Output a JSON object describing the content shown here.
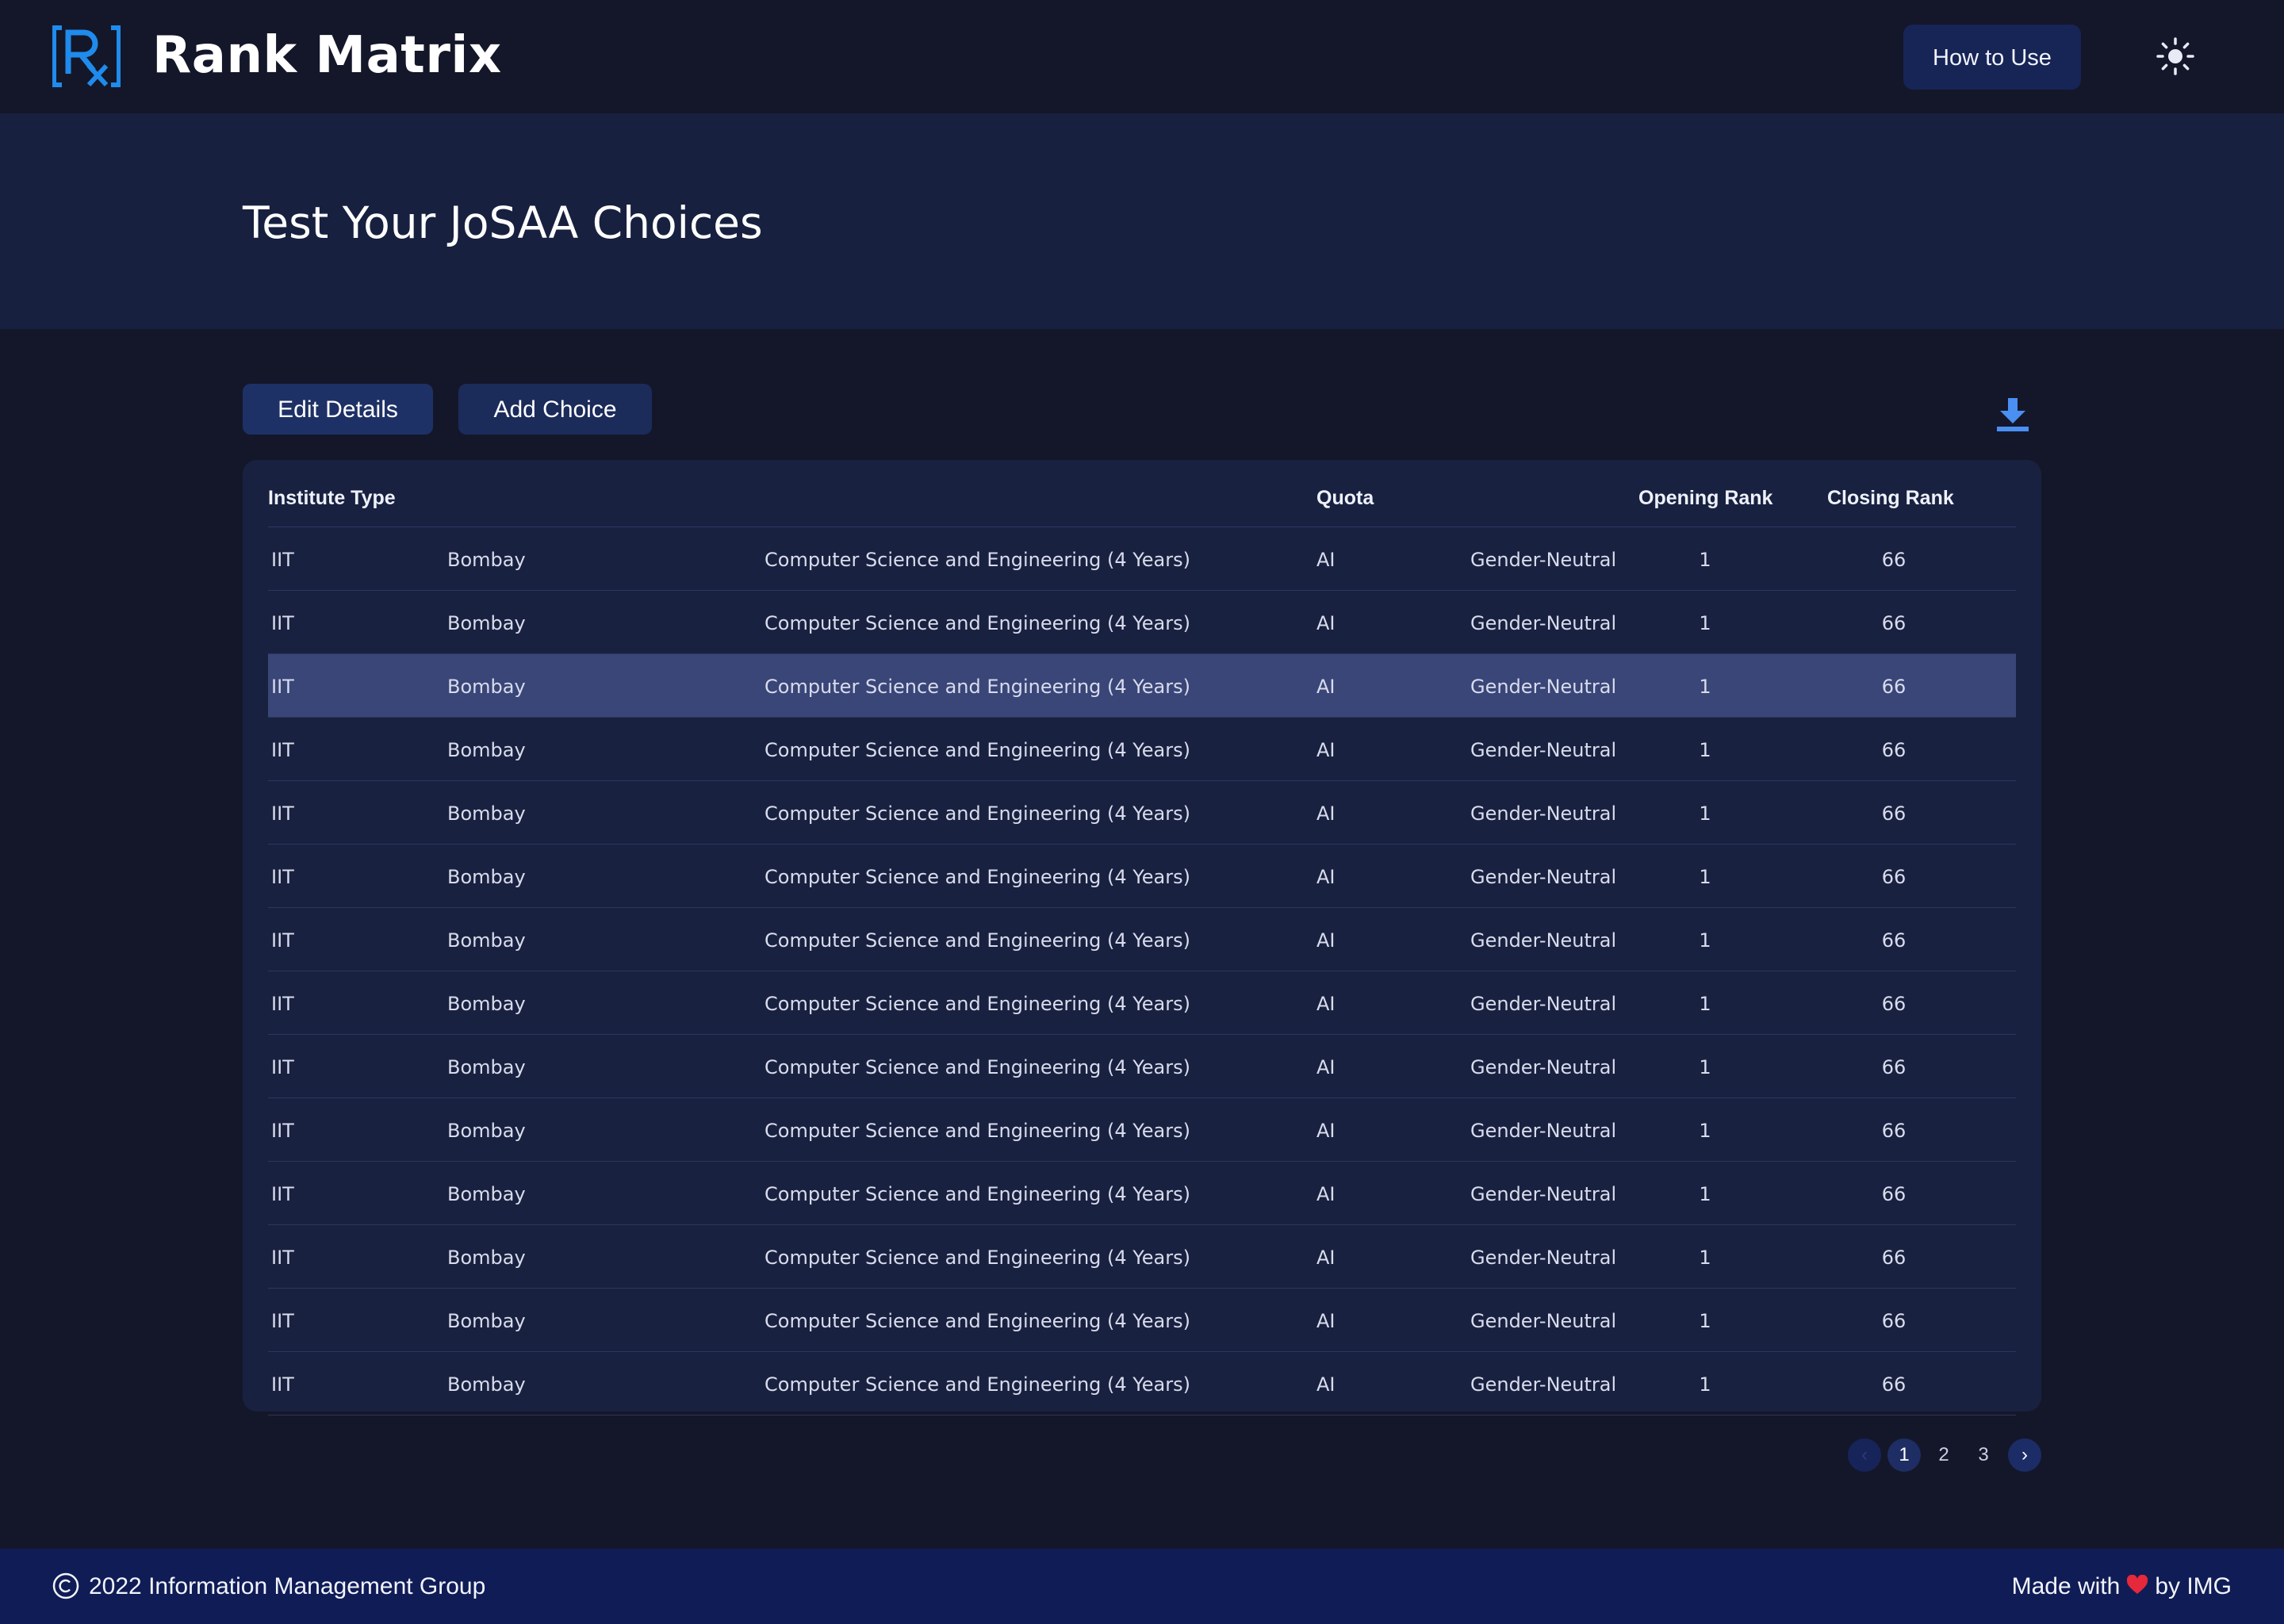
{
  "header": {
    "app_name": "Rank Matrix",
    "how_to_use_label": "How to Use",
    "theme_icon": "sun-icon",
    "logo_icon": "rx-logo-icon"
  },
  "hero": {
    "title": "Test Your JoSAA Choices"
  },
  "actions": {
    "edit_label": "Edit Details",
    "add_label": "Add Choice",
    "download_icon": "download-icon"
  },
  "table": {
    "headers": {
      "institute_type": "Institute Type",
      "quota": "Quota",
      "opening_rank": "Opening Rank",
      "closing_rank": "Closing Rank"
    },
    "highlighted_row": 2,
    "rows": [
      {
        "type": "IIT",
        "institute": "Bombay",
        "program": "Computer Science and Engineering (4 Years)",
        "quota": "AI",
        "gender": "Gender-Neutral",
        "opening": "1",
        "closing": "66"
      },
      {
        "type": "IIT",
        "institute": "Bombay",
        "program": "Computer Science and Engineering (4 Years)",
        "quota": "AI",
        "gender": "Gender-Neutral",
        "opening": "1",
        "closing": "66"
      },
      {
        "type": "IIT",
        "institute": "Bombay",
        "program": "Computer Science and Engineering (4 Years)",
        "quota": "AI",
        "gender": "Gender-Neutral",
        "opening": "1",
        "closing": "66"
      },
      {
        "type": "IIT",
        "institute": "Bombay",
        "program": "Computer Science and Engineering (4 Years)",
        "quota": "AI",
        "gender": "Gender-Neutral",
        "opening": "1",
        "closing": "66"
      },
      {
        "type": "IIT",
        "institute": "Bombay",
        "program": "Computer Science and Engineering (4 Years)",
        "quota": "AI",
        "gender": "Gender-Neutral",
        "opening": "1",
        "closing": "66"
      },
      {
        "type": "IIT",
        "institute": "Bombay",
        "program": "Computer Science and Engineering (4 Years)",
        "quota": "AI",
        "gender": "Gender-Neutral",
        "opening": "1",
        "closing": "66"
      },
      {
        "type": "IIT",
        "institute": "Bombay",
        "program": "Computer Science and Engineering (4 Years)",
        "quota": "AI",
        "gender": "Gender-Neutral",
        "opening": "1",
        "closing": "66"
      },
      {
        "type": "IIT",
        "institute": "Bombay",
        "program": "Computer Science and Engineering (4 Years)",
        "quota": "AI",
        "gender": "Gender-Neutral",
        "opening": "1",
        "closing": "66"
      },
      {
        "type": "IIT",
        "institute": "Bombay",
        "program": "Computer Science and Engineering (4 Years)",
        "quota": "AI",
        "gender": "Gender-Neutral",
        "opening": "1",
        "closing": "66"
      },
      {
        "type": "IIT",
        "institute": "Bombay",
        "program": "Computer Science and Engineering (4 Years)",
        "quota": "AI",
        "gender": "Gender-Neutral",
        "opening": "1",
        "closing": "66"
      },
      {
        "type": "IIT",
        "institute": "Bombay",
        "program": "Computer Science and Engineering (4 Years)",
        "quota": "AI",
        "gender": "Gender-Neutral",
        "opening": "1",
        "closing": "66"
      },
      {
        "type": "IIT",
        "institute": "Bombay",
        "program": "Computer Science and Engineering (4 Years)",
        "quota": "AI",
        "gender": "Gender-Neutral",
        "opening": "1",
        "closing": "66"
      },
      {
        "type": "IIT",
        "institute": "Bombay",
        "program": "Computer Science and Engineering (4 Years)",
        "quota": "AI",
        "gender": "Gender-Neutral",
        "opening": "1",
        "closing": "66"
      },
      {
        "type": "IIT",
        "institute": "Bombay",
        "program": "Computer Science and Engineering (4 Years)",
        "quota": "AI",
        "gender": "Gender-Neutral",
        "opening": "1",
        "closing": "66"
      }
    ]
  },
  "pagination": {
    "prev_icon": "chevron-left-icon",
    "next_icon": "chevron-right-icon",
    "pages": [
      "1",
      "2",
      "3"
    ],
    "current_page": "1"
  },
  "footer": {
    "copyright_text": "2022 Information Management Group",
    "made_with_prefix": "Made with",
    "made_with_suffix": "by IMG",
    "copyright_icon": "copyright-icon",
    "heart_icon": "heart-icon"
  },
  "colors": {
    "background": "#14172a",
    "hero": "#182040",
    "card": "#192140",
    "highlight_row": "#3a4678",
    "accent": "#3f8cf0",
    "footer": "#101c56"
  }
}
